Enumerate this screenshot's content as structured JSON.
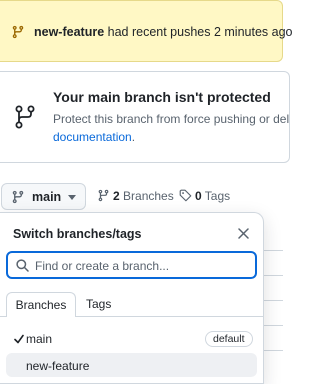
{
  "banner": {
    "branch_name": "new-feature",
    "message": " had recent pushes 2 minutes ago"
  },
  "protection": {
    "title": "Your main branch isn't protected",
    "description": "Protect this branch from force pushing or del",
    "link": "documentation",
    "link_suffix": "."
  },
  "branch_bar": {
    "current_branch": "main",
    "branches_count": "2",
    "branches_label": " Branches",
    "tags_count": "0",
    "tags_label": " Tags"
  },
  "dropdown": {
    "title": "Switch branches/tags",
    "search_placeholder": "Find or create a branch...",
    "tabs": [
      "Branches",
      "Tags"
    ],
    "branches": [
      {
        "name": "main",
        "selected": true,
        "badge": "default"
      },
      {
        "name": "new-feature",
        "selected": false,
        "badge": ""
      }
    ]
  },
  "colors": {
    "banner_bg": "#fff8c5",
    "link": "#0969da",
    "focus_border": "#0969da"
  }
}
